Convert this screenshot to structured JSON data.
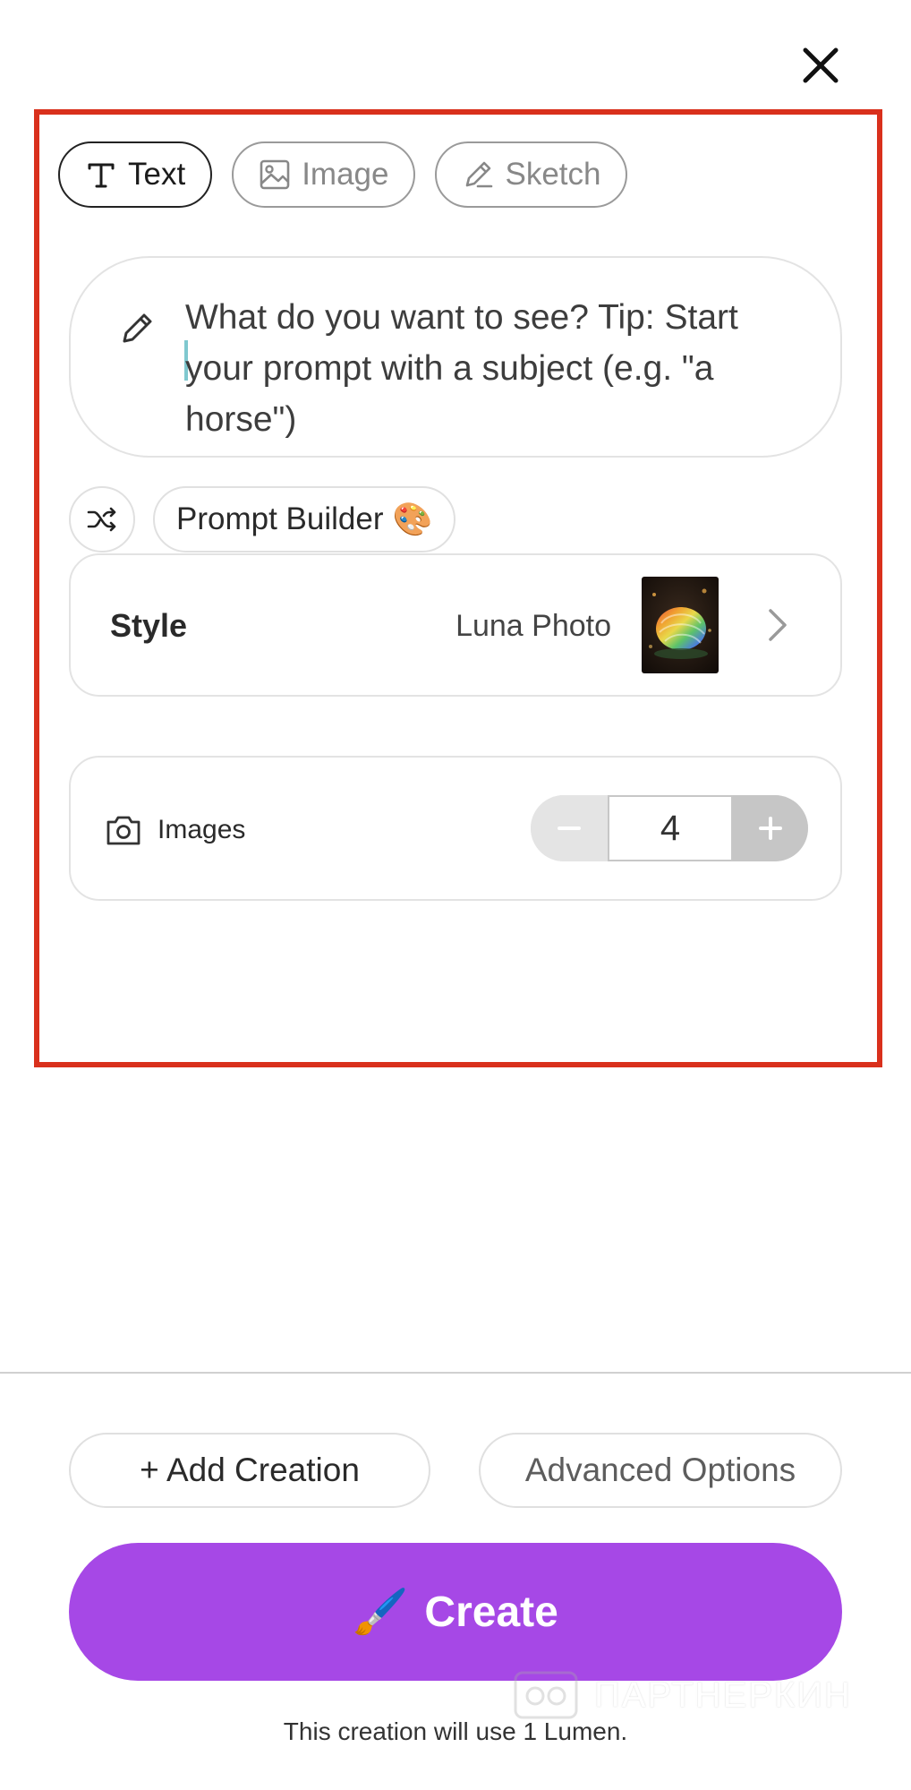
{
  "header": {
    "close_icon": "close-icon"
  },
  "mode_tabs": [
    {
      "label": "Text",
      "icon": "text-icon",
      "active": true
    },
    {
      "label": "Image",
      "icon": "image-icon",
      "active": false
    },
    {
      "label": "Sketch",
      "icon": "pencil-icon",
      "active": false
    }
  ],
  "prompt": {
    "icon": "pencil-icon",
    "placeholder": "What do you want to see? Tip: Start your prompt with a subject (e.g. \"a horse\")"
  },
  "prompt_tools": {
    "shuffle_icon": "shuffle-icon",
    "builder_label": "Prompt Builder",
    "builder_emoji": "🎨"
  },
  "style": {
    "label": "Style",
    "value": "Luna Photo",
    "thumbnail": "style-thumbnail",
    "chevron": "chevron-right-icon"
  },
  "images": {
    "icon": "camera-icon",
    "label": "Images",
    "count": "4",
    "minus_icon": "minus-icon",
    "plus_icon": "plus-icon"
  },
  "footer": {
    "add_creation_label": "+ Add Creation",
    "advanced_options_label": "Advanced Options",
    "create_emoji": "🖌️",
    "create_label": "Create",
    "usage_note": "This creation will use 1 Lumen."
  },
  "watermark": {
    "text": "ПАРТНЕРКИН"
  },
  "colors": {
    "accent": "#a648e6",
    "highlight_frame": "#d9301c",
    "caret": "#7fc8cf"
  }
}
